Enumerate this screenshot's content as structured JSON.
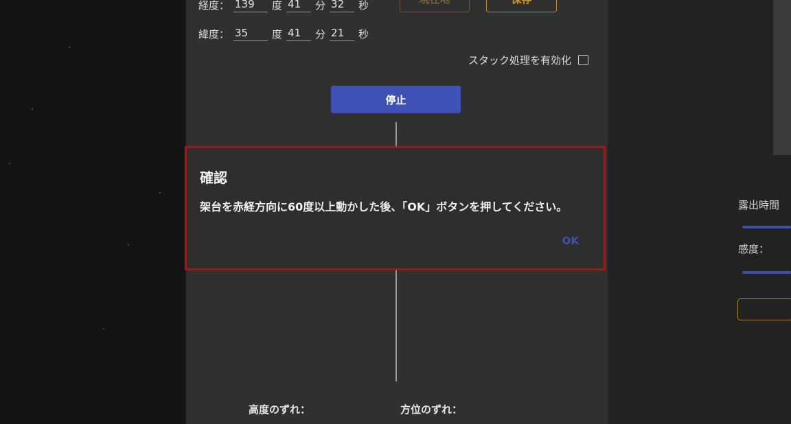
{
  "location": {
    "longitude": {
      "label": "経度：",
      "deg": "139",
      "deg_unit": "度",
      "min": "41",
      "min_unit": "分",
      "sec": "32",
      "sec_unit": "秒"
    },
    "latitude": {
      "label": "緯度：",
      "deg": "35",
      "deg_unit": "度",
      "min": "41",
      "min_unit": "分",
      "sec": "21",
      "sec_unit": "秒"
    },
    "current_location_button": "現在地",
    "save_button": "保存"
  },
  "stacking": {
    "label": "スタック処理を有効化",
    "checked": false
  },
  "stop_button": "停止",
  "deviation": {
    "altitude_label": "高度のずれ：",
    "azimuth_label": "方位のずれ："
  },
  "right_panel": {
    "exposure_label": "露出時間",
    "sensitivity_label": "感度："
  },
  "dialog": {
    "title": "確認",
    "message": "架台を赤経方向に60度以上動かした後、「OK」ボタンを押してください。",
    "ok_button": "OK"
  },
  "colors": {
    "accent_blue": "#3f51b5",
    "gold": "#c79a35",
    "highlight_red": "#d50000"
  }
}
